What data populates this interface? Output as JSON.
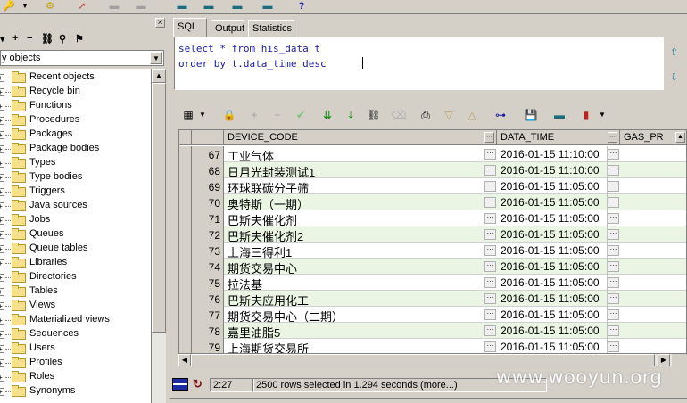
{
  "toolbar": {
    "icons": [
      "key-icon",
      "dropdown-icon",
      "gear-icon",
      "arrow-icon",
      "db-icon",
      "db-icon",
      "db-icon",
      "db-icon",
      "db-icon",
      "help-icon"
    ]
  },
  "left_panel": {
    "object_filter": "y objects",
    "tree_items": [
      "Recent objects",
      "Recycle bin",
      "Functions",
      "Procedures",
      "Packages",
      "Package bodies",
      "Types",
      "Type bodies",
      "Triggers",
      "Java sources",
      "Jobs",
      "Queues",
      "Queue tables",
      "Libraries",
      "Directories",
      "Tables",
      "Views",
      "Materialized views",
      "Sequences",
      "Users",
      "Profiles",
      "Roles",
      "Synonyms"
    ]
  },
  "tabs": [
    "SQL",
    "Output",
    "Statistics"
  ],
  "sql": {
    "line1": "select * from his_data t",
    "line2": "order by t.data_time desc"
  },
  "grid": {
    "headers": [
      "DEVICE_CODE",
      "DATA_TIME",
      "GAS_PR"
    ],
    "rows": [
      {
        "num": "67",
        "code": "工业气体",
        "time": "2016-01-15 11:10:00"
      },
      {
        "num": "68",
        "code": "日月光封装测试1",
        "time": "2016-01-15 11:10:00"
      },
      {
        "num": "69",
        "code": "环球联碳分子筛",
        "time": "2016-01-15 11:05:00"
      },
      {
        "num": "70",
        "code": "奥特斯（一期）",
        "time": "2016-01-15 11:05:00"
      },
      {
        "num": "71",
        "code": "巴斯夫催化剂",
        "time": "2016-01-15 11:05:00"
      },
      {
        "num": "72",
        "code": "巴斯夫催化剂2",
        "time": "2016-01-15 11:05:00"
      },
      {
        "num": "73",
        "code": "上海三得利1",
        "time": "2016-01-15 11:05:00"
      },
      {
        "num": "74",
        "code": "期货交易中心",
        "time": "2016-01-15 11:05:00"
      },
      {
        "num": "75",
        "code": "拉法基",
        "time": "2016-01-15 11:05:00"
      },
      {
        "num": "76",
        "code": "巴斯夫应用化工",
        "time": "2016-01-15 11:05:00"
      },
      {
        "num": "77",
        "code": "期货交易中心（二期）",
        "time": "2016-01-15 11:05:00"
      },
      {
        "num": "78",
        "code": "嘉里油脂5",
        "time": "2016-01-15 11:05:00"
      },
      {
        "num": "79",
        "code": "上海期货交易所",
        "time": "2016-01-15 11:05:00"
      }
    ],
    "cell_button": "···"
  },
  "status": {
    "position": "2:27",
    "message": "2500 rows selected in 1.294 seconds (more...)"
  },
  "watermark": "www.wooyun.org"
}
